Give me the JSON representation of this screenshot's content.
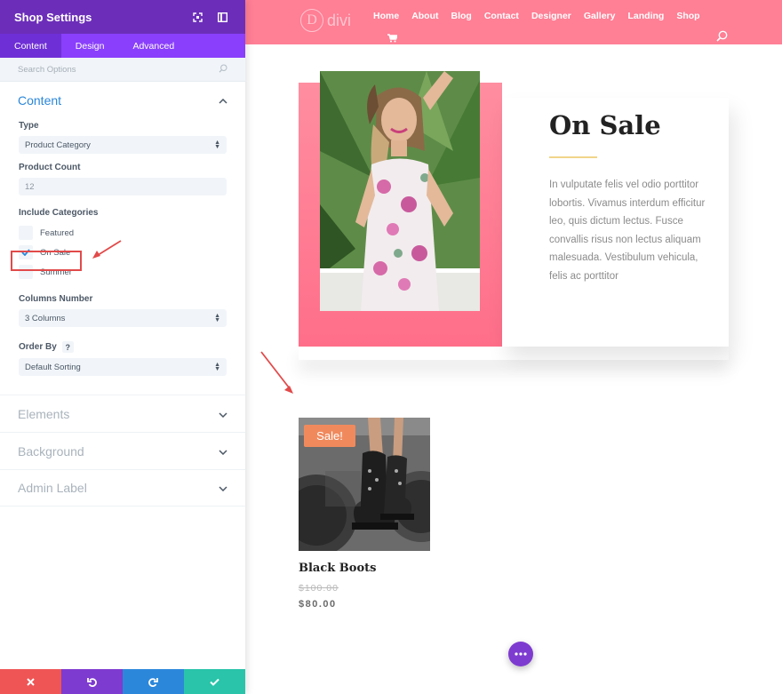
{
  "panel": {
    "title": "Shop Settings",
    "tabs": [
      {
        "label": "Content",
        "active": true
      },
      {
        "label": "Design",
        "active": false
      },
      {
        "label": "Advanced",
        "active": false
      }
    ],
    "search_placeholder": "Search Options",
    "content_section": {
      "label": "Content",
      "type_label": "Type",
      "type_value": "Product Category",
      "count_label": "Product Count",
      "count_value": "12",
      "categories_label": "Include Categories",
      "categories": [
        {
          "label": "Featured",
          "checked": false
        },
        {
          "label": "On Sale",
          "checked": true
        },
        {
          "label": "Summer",
          "checked": false
        }
      ],
      "columns_label": "Columns Number",
      "columns_value": "3 Columns",
      "orderby_label": "Order By",
      "orderby_help": "?",
      "orderby_value": "Default Sorting"
    },
    "collapsed_sections": [
      "Elements",
      "Background",
      "Admin Label"
    ],
    "bottom_bar": {
      "colors": [
        "#ef5555",
        "#7e3bd0",
        "#2b87da",
        "#29c4a9"
      ]
    }
  },
  "page": {
    "logo_letter": "D",
    "logo_text": "divi",
    "menu": [
      "Home",
      "About",
      "Blog",
      "Contact",
      "Designer",
      "Gallery",
      "Landing",
      "Shop"
    ],
    "nav_color": "#ff7f95",
    "hero": {
      "title": "On Sale",
      "body": "In vulputate felis vel odio porttitor lobortis. Vivamus interdum efficitur leo, quis dictum lectus. Fusce convallis risus non lectus aliquam malesuada. Vestibulum vehicula, felis ac porttitor"
    },
    "product": {
      "badge": "Sale!",
      "name": "Black Boots",
      "old_price": "$100.00",
      "new_price": "$80.00"
    }
  }
}
